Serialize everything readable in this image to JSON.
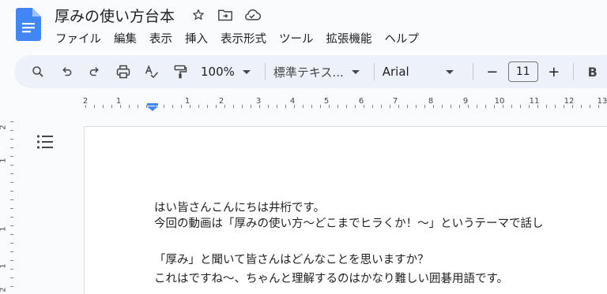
{
  "app": {
    "doc_title": "厚みの使い方台本",
    "title_icons": [
      "star-icon",
      "move-to-folder-icon",
      "cloud-saved-icon"
    ]
  },
  "menu": [
    "ファイル",
    "編集",
    "表示",
    "挿入",
    "表示形式",
    "ツール",
    "拡張機能",
    "ヘルプ"
  ],
  "toolbar": {
    "icons": [
      "search-icon",
      "undo-icon",
      "redo-icon",
      "print-icon",
      "spellcheck-icon",
      "paint-format-icon"
    ],
    "zoom": "100%",
    "style": "標準テキス...",
    "font": "Arial",
    "minus": "−",
    "font_size": "11",
    "plus": "+",
    "bold": "B"
  },
  "ruler": {
    "labels": [
      "2",
      "1",
      "1",
      "2",
      "3",
      "4",
      "5",
      "6",
      "7",
      "8",
      "9",
      "10",
      "11",
      "12",
      "13"
    ]
  },
  "vruler": {
    "labels": [
      "2",
      "1",
      "1",
      "1",
      "2"
    ]
  },
  "document": {
    "lines": [
      "はい皆さんこんにちは井桁です。",
      "今回の動画は「厚みの使い方〜どこまでヒラくか！〜」というテーマで話し",
      "",
      "「厚み」と聞いて皆さんはどんなことを思いますか？",
      "これはですね〜、ちゃんと理解するのはかなり難しい囲碁用語です。"
    ]
  },
  "colors": {
    "accent": "#4285f4",
    "toolbar_bg": "#edf2fa",
    "canvas_bg": "#f9fbfd"
  }
}
